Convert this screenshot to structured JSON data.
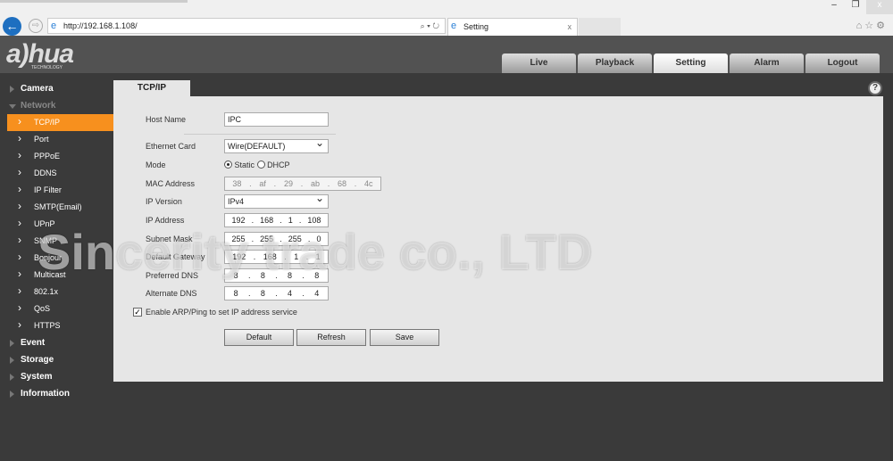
{
  "browser": {
    "url": "http://192.168.1.108/",
    "tab_title": "Setting",
    "tools": "⌕ ▾ ↻",
    "close": "x",
    "window_controls": [
      "–",
      "❐",
      "x"
    ],
    "right_tools": "⌂☆⚙"
  },
  "header": {
    "logo": "a)hua",
    "logo_sub": "TECHNOLOGY",
    "nav": [
      "Live",
      "Playback",
      "Setting",
      "Alarm",
      "Logout"
    ],
    "active_nav": "Setting"
  },
  "sidebar": {
    "groups_top": [
      "Camera",
      "Network"
    ],
    "network_items": [
      "TCP/IP",
      "Port",
      "PPPoE",
      "DDNS",
      "IP Filter",
      "SMTP(Email)",
      "UPnP",
      "SNMP",
      "Bonjour",
      "Multicast",
      "802.1x",
      "QoS",
      "HTTPS"
    ],
    "groups_bottom": [
      "Event",
      "Storage",
      "System",
      "Information"
    ]
  },
  "panel": {
    "tab": "TCP/IP",
    "help": "?",
    "labels": {
      "host": "Host Name",
      "eth": "Ethernet Card",
      "mode": "Mode",
      "mac": "MAC Address",
      "ipver": "IP Version",
      "ip": "IP Address",
      "mask": "Subnet Mask",
      "gw": "Default Gateway",
      "dns1": "Preferred DNS",
      "dns2": "Alternate DNS"
    },
    "host_name": "IPC",
    "ethernet_card": "Wire(DEFAULT)",
    "mode_static": "Static",
    "mode_dhcp": "DHCP",
    "mode_selected": "Static",
    "mac": [
      "38",
      "af",
      "29",
      "ab",
      "68",
      "4c"
    ],
    "ip_version": "IPv4",
    "ip": [
      "192",
      "168",
      "1",
      "108"
    ],
    "mask": [
      "255",
      "255",
      "255",
      "0"
    ],
    "gateway": [
      "192",
      "168",
      "1",
      "1"
    ],
    "dns1": [
      "8",
      "8",
      "8",
      "8"
    ],
    "dns2": [
      "8",
      "8",
      "4",
      "4"
    ],
    "arp_label": "Enable ARP/Ping to set IP address service",
    "arp_checked": true,
    "buttons": {
      "default": "Default",
      "refresh": "Refresh",
      "save": "Save"
    }
  },
  "watermark": "Sincerity trade co., LTD"
}
